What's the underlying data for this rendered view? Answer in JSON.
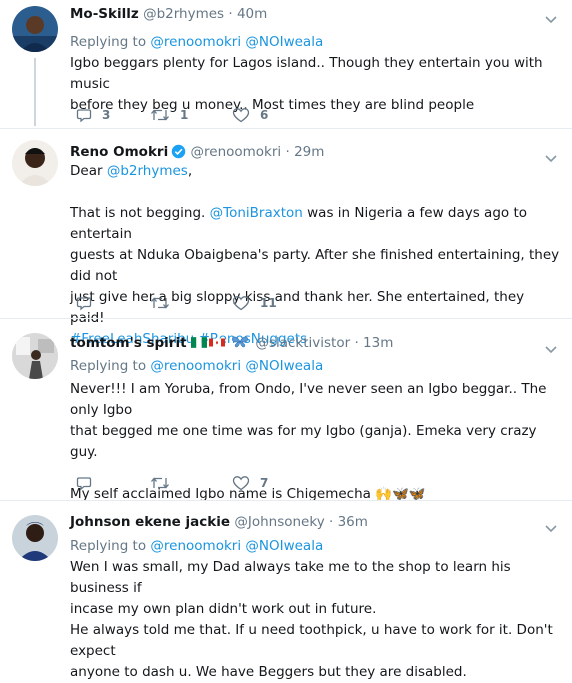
{
  "tweets": [
    {
      "name": "Mo-Skillz",
      "handle": "@b2rhymes",
      "dot": "·",
      "time": "40m",
      "reply_prefix": "Replying to",
      "reply_to_1": "@renoomokri",
      "reply_to_2": "@NOIweala",
      "line1": "Igbo beggars plenty for Lagos island.. Though they entertain you with music",
      "line2": "before they beg u money.. Most times they are blind people",
      "replies": "3",
      "retweets": "1",
      "likes": "6"
    },
    {
      "name": "Reno Omokri",
      "handle": "@renoomokri",
      "dot": "·",
      "time": "29m",
      "verified": true,
      "greeting_prefix": "Dear",
      "greeting_mention": "@b2rhymes",
      "greeting_suffix": ",",
      "p_start": "That is not begging.",
      "p_mention": "@ToniBraxton",
      "p_rest_1": "was in Nigeria a few days ago to entertain",
      "p_line2": "guests at Nduka Obaigbena's party. After she finished entertaining, they did not",
      "p_line3": "just give her a big sloppy kiss and thank her. She entertained, they paid!",
      "hashtag_1": "#FreeLeahSharibu",
      "hashtag_2": "#RenosNuggets",
      "replies": "",
      "retweets": "",
      "likes": "11"
    },
    {
      "name": "tomtom's spirit",
      "handle": "@slacktivistor",
      "dot": "·",
      "time": "13m",
      "reply_prefix": "Replying to",
      "reply_to_1": "@renoomokri",
      "reply_to_2": "@NOIweala",
      "line1": "Never!!! I am Yoruba, from Ondo, I've never seen an Igbo beggar.. The only Igbo",
      "line2": "that begged me one time was for my Igbo (ganja). Emeka very crazy guy.",
      "line3": "My self acclaimed Igbo name is Chigemecha",
      "emoji": "🙌🦋🦋",
      "replies": "",
      "retweets": "",
      "likes": "7"
    },
    {
      "name": "Johnson ekene jackie",
      "handle": "@Johnsoneky",
      "dot": "·",
      "time": "36m",
      "reply_prefix": "Replying to",
      "reply_to_1": "@renoomokri",
      "reply_to_2": "@NOIweala",
      "line1": "Wen I was small, my Dad always take me to the shop to learn his business if",
      "line2": "incase my own plan didn't work out in future.",
      "line3": "He always told me that. If u need toothpick, u have to work for it. Don't expect",
      "line4": "anyone to dash u. We have Beggers but they are disabled."
    }
  ],
  "colors": {
    "link": "#1b95e0",
    "muted": "#657786",
    "text": "#14171a",
    "divider": "#e6ecf0"
  },
  "icons": [
    "reply-icon",
    "retweet-icon",
    "like-icon",
    "chevron-down-icon",
    "verified-badge-icon",
    "butterfly-icon"
  ]
}
